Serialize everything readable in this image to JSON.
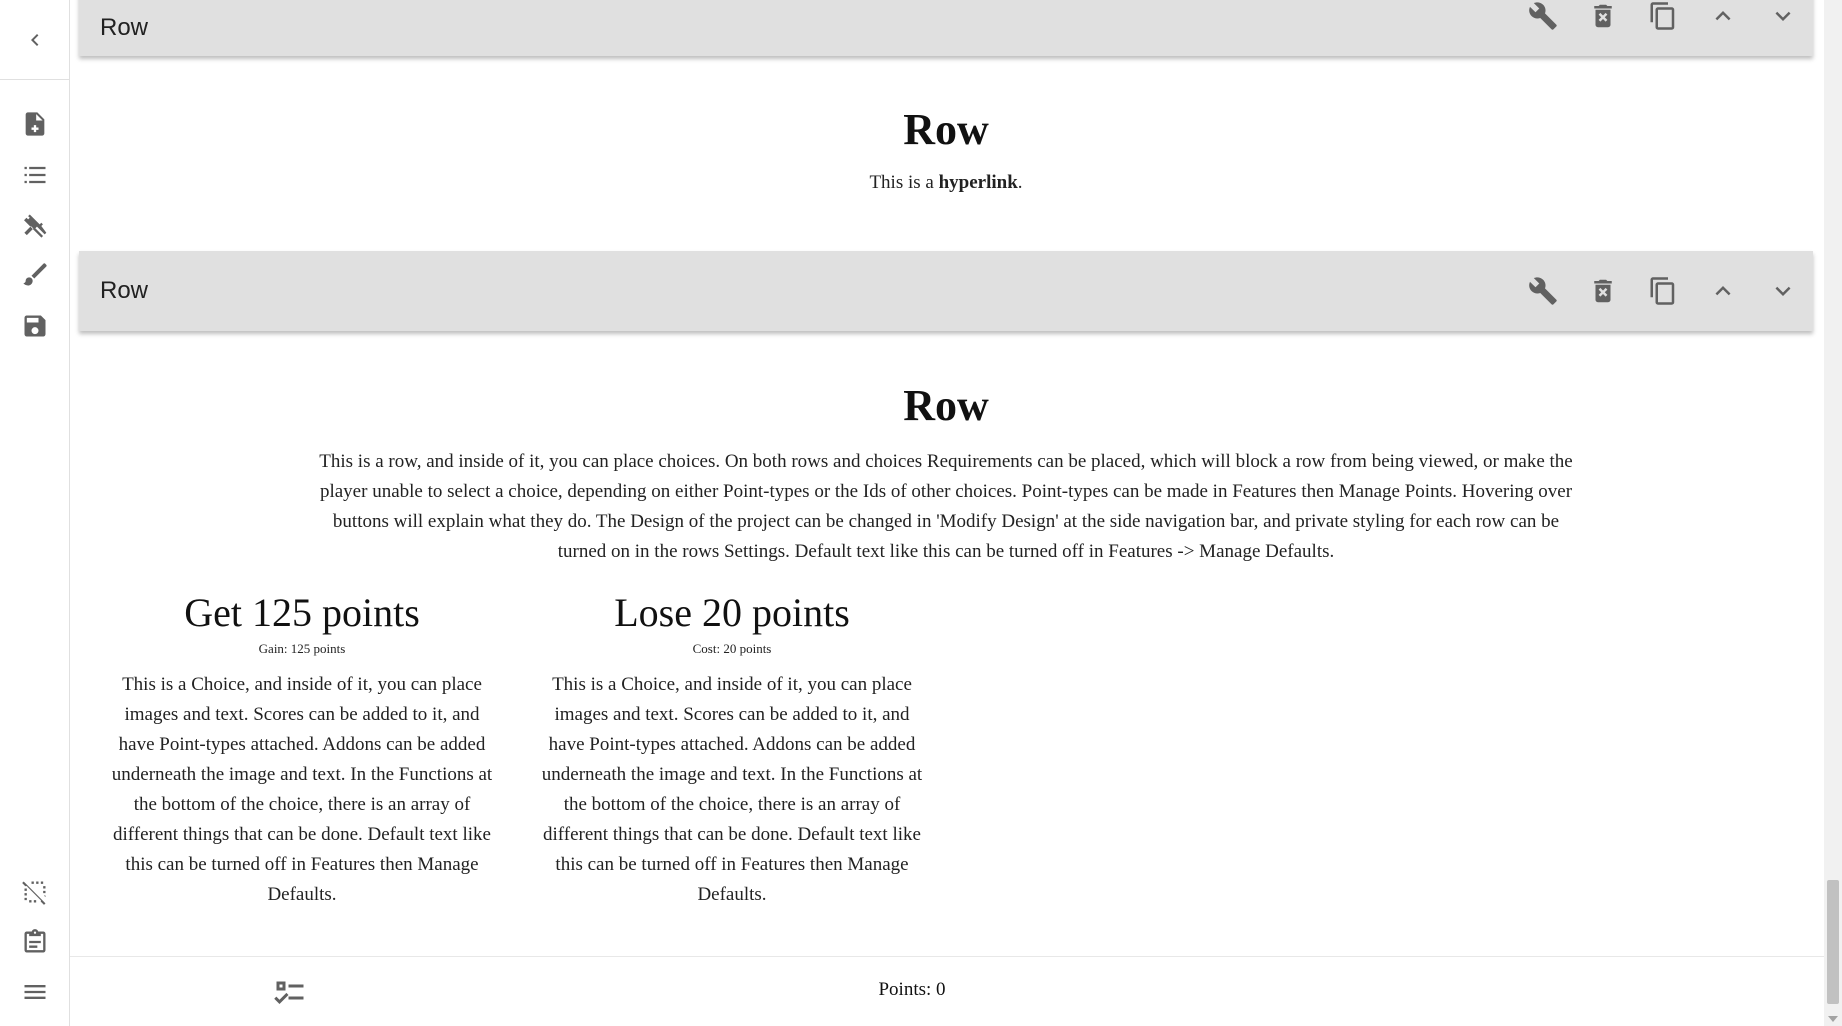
{
  "rows": [
    {
      "toolbar_title": "Row"
    },
    {
      "toolbar_title": "Row"
    }
  ],
  "row1": {
    "title": "Row",
    "text_prefix": "This is a ",
    "link": "hyperlink",
    "text_suffix": "."
  },
  "row2": {
    "title": "Row",
    "text": "This is a row, and inside of it, you can place choices. On both rows and choices Requirements can be placed, which will block a row from being viewed, or make the player unable to select a choice, depending on either Point-types or the Ids of other choices. Point-types can be made in Features then Manage Points. Hovering over buttons will explain what they do. The Design of the project can be changed in 'Modify Design' at the side navigation bar, and private styling for each row can be turned on in the rows Settings. Default text like this can be turned off in Features -> Manage Defaults."
  },
  "choices": [
    {
      "title": "Get 125 points",
      "score": "Gain: 125 points",
      "text": "This is a Choice, and inside of it, you can place images and text. Scores can be added to it, and have Point-types attached. Addons can be added underneath the image and text. In the Functions at the bottom of the choice, there is an array of different things that can be done. Default text like this can be turned off in Features then Manage Defaults."
    },
    {
      "title": "Lose 20 points",
      "score": "Cost: 20 points",
      "text": "This is a Choice, and inside of it, you can place images and text. Scores can be added to it, and have Point-types attached. Addons can be added underneath the image and text. In the Functions at the bottom of the choice, there is an array of different things that can be done. Default text like this can be turned off in Features then Manage Defaults."
    }
  ],
  "bottom": {
    "points": "Points: 0"
  },
  "icons": {
    "rail": [
      "chevron-left-icon",
      "file-plus-icon",
      "list-icon",
      "tools-icon",
      "brush-icon",
      "save-icon",
      "selection-off-icon",
      "clipboard-icon",
      "menu-icon"
    ],
    "toolbar": [
      "wrench-icon",
      "delete-icon",
      "copy-icon",
      "chevron-up-icon",
      "chevron-down-icon"
    ],
    "bottom": "checklist-icon"
  }
}
